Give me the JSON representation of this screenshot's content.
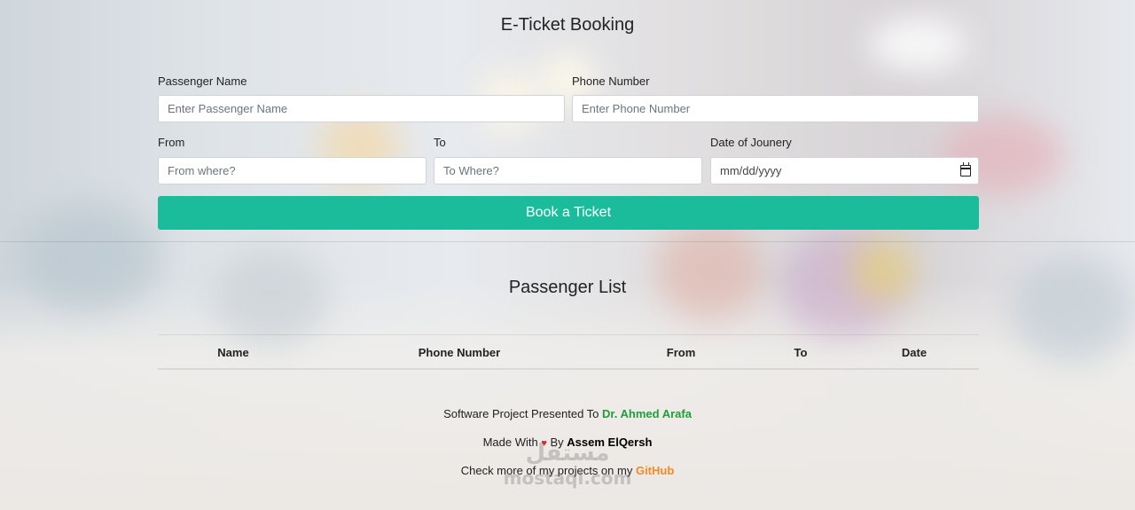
{
  "header": {
    "title": "E-Ticket Booking"
  },
  "form": {
    "passenger_name": {
      "label": "Passenger Name",
      "placeholder": "Enter Passenger Name"
    },
    "phone_number": {
      "label": "Phone Number",
      "placeholder": "Enter Phone Number"
    },
    "from": {
      "label": "From",
      "placeholder": "From where?"
    },
    "to": {
      "label": "To",
      "placeholder": "To Where?"
    },
    "date": {
      "label": "Date of Jounery",
      "placeholder": "mm/dd/yyyy",
      "icon": "calendar-icon"
    },
    "submit_label": "Book a Ticket"
  },
  "passenger_list": {
    "title": "Passenger List",
    "columns": [
      "Name",
      "Phone Number",
      "From",
      "To",
      "Date"
    ]
  },
  "footer": {
    "line1_prefix": "Software Project Presented To ",
    "line1_name": "Dr. Ahmed Arafa",
    "line2_prefix": "Made With ",
    "line2_heart": "♥",
    "line2_by": " By ",
    "line2_name": "Assem ElQersh",
    "line3_prefix": "Check more of my projects on my ",
    "line3_link": "GitHub"
  },
  "watermark": {
    "top": "مستقل",
    "bottom": "mostaql.com"
  },
  "colors": {
    "accent": "#1abc9c",
    "teacher_name": "#1f9d3a",
    "github_link": "#f08a24",
    "heart": "#e02424"
  }
}
